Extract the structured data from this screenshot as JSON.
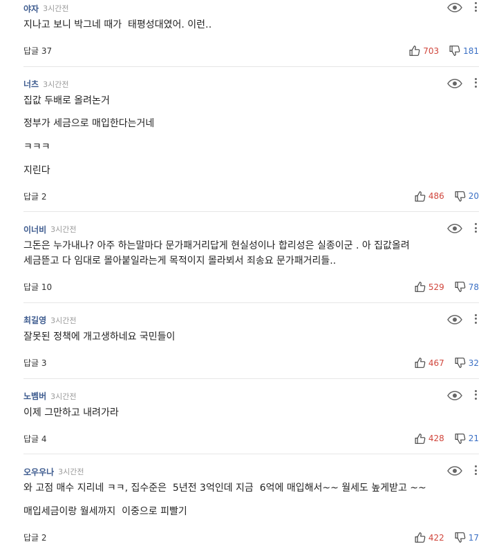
{
  "comments": [
    {
      "author": "야자",
      "time": "3시간전",
      "lines": [
        "지나고 보니 박그네 때가  태평성대였어. 이런‥"
      ],
      "replies": "답글 37",
      "up": "703",
      "down": "181"
    },
    {
      "author": "너츠",
      "time": "3시간전",
      "lines": [
        "집값 두배로 올려논거",
        "정부가 세금으로 매입한다는거네",
        "ㅋㅋㅋ",
        "지린다"
      ],
      "replies": "답글 2",
      "up": "486",
      "down": "20"
    },
    {
      "author": "이너비",
      "time": "3시간전",
      "lines": [
        "그돈은 누가내나? 아주 하는말마다 문가패거리답게 현실성이나 합리성은 실종이군 . 아 집값올려\n세금뜯고 다 임대로 몰아붙일라는게 목적이지 몰라뵈서 죄송요 문가패거리들.."
      ],
      "replies": "답글 10",
      "up": "529",
      "down": "78"
    },
    {
      "author": "최길영",
      "time": "3시간전",
      "lines": [
        "잘못된 정책에 개고생하네요 국민들이"
      ],
      "replies": "답글 3",
      "up": "467",
      "down": "32"
    },
    {
      "author": "노벰버",
      "time": "3시간전",
      "lines": [
        "이제 그만하고 내려가라"
      ],
      "replies": "답글 4",
      "up": "428",
      "down": "21"
    },
    {
      "author": "오우우나",
      "time": "3시간전",
      "lines": [
        "와 고점 매수 지리네 ㅋㅋ, 집수준은  5년전 3억인데 지금  6억에 매입해서~~ 월세도 높게받고 ~~",
        "매입세금이랑 월세까지  이중으로 피빨기"
      ],
      "replies": "답글 2",
      "up": "422",
      "down": "17"
    }
  ]
}
